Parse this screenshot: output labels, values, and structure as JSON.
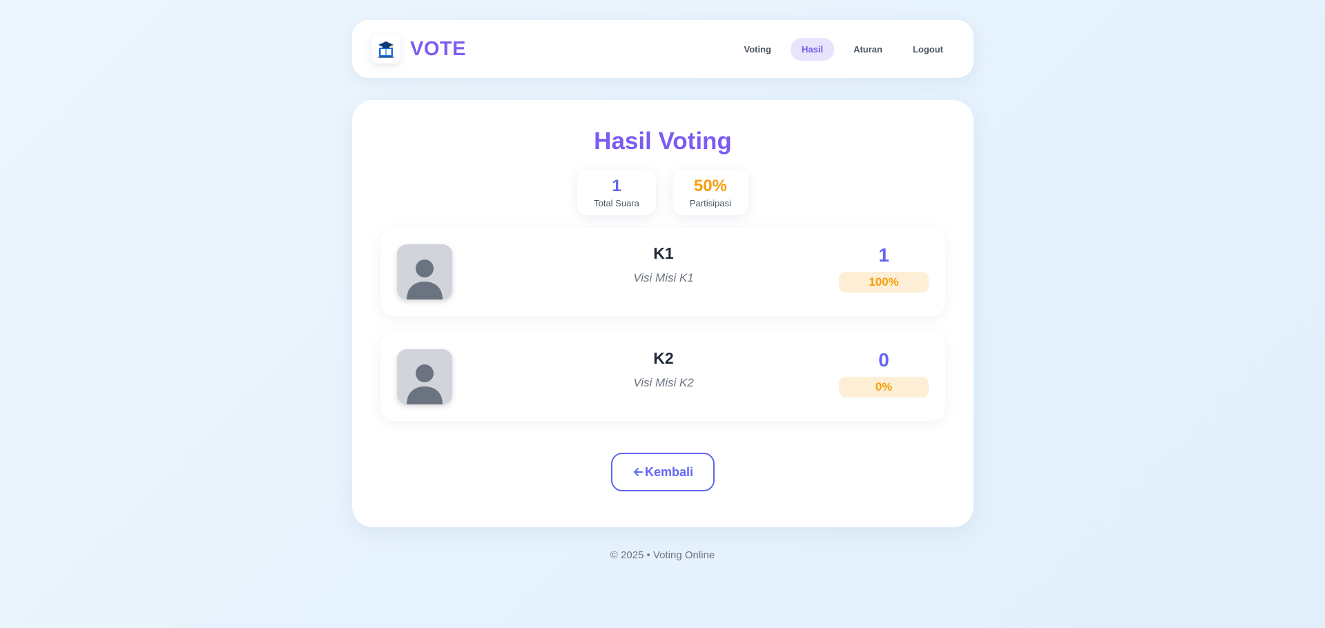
{
  "brand": {
    "name": "VOTE",
    "logo_icon": "graduation-book-icon"
  },
  "nav": {
    "items": [
      {
        "label": "Voting",
        "active": false
      },
      {
        "label": "Hasil",
        "active": true
      },
      {
        "label": "Aturan",
        "active": false
      },
      {
        "label": "Logout",
        "active": false
      }
    ]
  },
  "page": {
    "title": "Hasil Voting"
  },
  "stats": {
    "total_votes": {
      "value": "1",
      "label": "Total Suara",
      "color": "#6366f1"
    },
    "participation": {
      "value": "50%",
      "label": "Partisipasi",
      "color": "#f59e0b"
    }
  },
  "candidates": [
    {
      "name": "K1",
      "description": "Visi Misi K1",
      "votes": "1",
      "percent": "100%",
      "avatar_icon": "person-placeholder-icon"
    },
    {
      "name": "K2",
      "description": "Visi Misi K2",
      "votes": "0",
      "percent": "0%",
      "avatar_icon": "person-placeholder-icon"
    }
  ],
  "back_button": {
    "label": "Kembali",
    "icon": "arrow-left-icon"
  },
  "footer": {
    "text": "© 2025 • Voting Online"
  },
  "colors": {
    "accent": "#7b5cf0",
    "primary": "#6366f1",
    "warning": "#f59e0b"
  }
}
